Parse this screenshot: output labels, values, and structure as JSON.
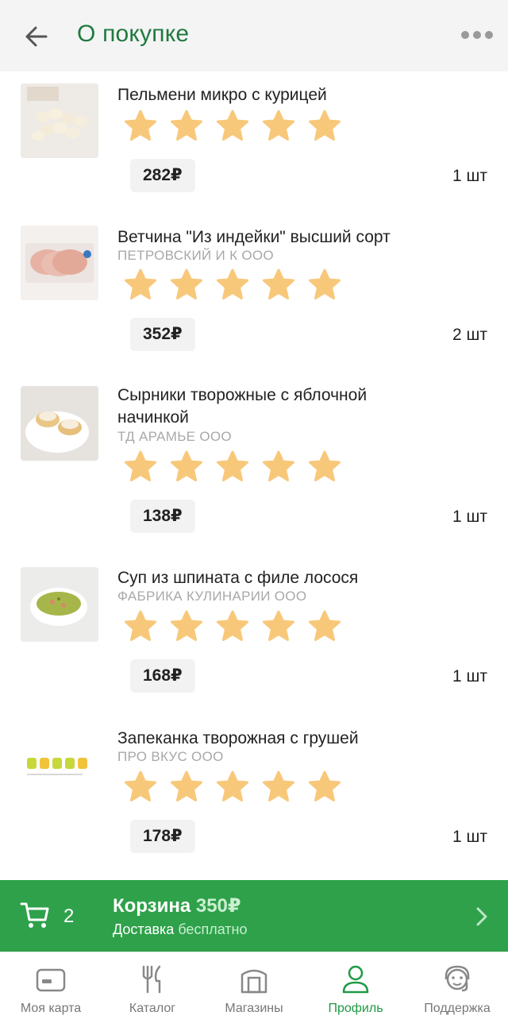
{
  "header": {
    "title": "О покупке",
    "back_icon": "arrow-left-icon",
    "more_icon": "more-dots-icon",
    "accent": "#1f7a3f"
  },
  "items": [
    {
      "name": "Пельмени микро с курицей",
      "maker": "",
      "rating": 5,
      "price": "282₽",
      "qty": "1 шт"
    },
    {
      "name": "Ветчина \"Из индейки\" высший сорт",
      "maker": "ПЕТРОВСКИЙ И К ООО",
      "rating": 5,
      "price": "352₽",
      "qty": "2 шт"
    },
    {
      "name": "Сырники творожные с яблочной начинкой",
      "maker": "ТД АРАМЬЕ ООО",
      "rating": 5,
      "price": "138₽",
      "qty": "1 шт"
    },
    {
      "name": "Суп из шпината с филе лосося",
      "maker": "ФАБРИКА КУЛИНАРИИ ООО",
      "rating": 5,
      "price": "168₽",
      "qty": "1 шт"
    },
    {
      "name": "Запеканка творожная с грушей",
      "maker": "ПРО ВКУС ООО",
      "rating": 5,
      "price": "178₽",
      "qty": "1 шт"
    }
  ],
  "star_color": "#f8c87a",
  "cart": {
    "count": "2",
    "title": "Корзина",
    "sum": "350₽",
    "delivery_label": "Доставка",
    "delivery_value": "бесплатно",
    "bg": "#2ea14a"
  },
  "tabs": [
    {
      "label": "Моя карта",
      "icon": "card-icon",
      "active": false
    },
    {
      "label": "Каталог",
      "icon": "fork-knife-icon",
      "active": false
    },
    {
      "label": "Магазины",
      "icon": "store-icon",
      "active": false
    },
    {
      "label": "Профиль",
      "icon": "profile-icon",
      "active": true
    },
    {
      "label": "Поддержка",
      "icon": "support-icon",
      "active": false
    }
  ]
}
